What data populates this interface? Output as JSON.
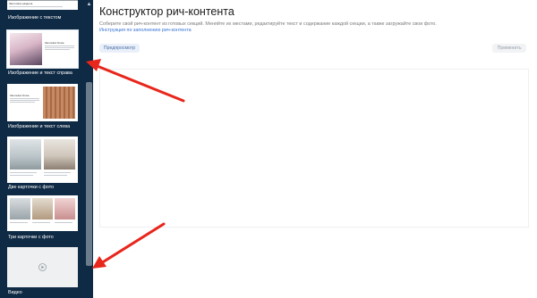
{
  "sidebar": {
    "items": [
      {
        "label": "Изображение с текстом",
        "thumb_heading": "Заголовок раздела"
      },
      {
        "label": "Изображение и текст справа",
        "thumb_heading": "Заголовок блока"
      },
      {
        "label": "Изображение и текст слева",
        "thumb_heading": "Заголовок блока"
      },
      {
        "label": "Две карточки с фото"
      },
      {
        "label": "Три карточки с фото"
      },
      {
        "label": "Видео"
      }
    ]
  },
  "main": {
    "title": "Конструктор рич-контента",
    "description": "Соберите свой рич-контент из готовых секций. Меняйте их местами, редактируйте текст и содержание каждой секции, а также загружайте свои фото.",
    "help_link": "Инструкция по заполнению рич-контента",
    "preview_button": "Предпросмотр",
    "apply_button": "Применить"
  },
  "colors": {
    "sidebar_bg": "#0f2a44",
    "annotation_arrow": "#e8261c",
    "link": "#3573d4"
  }
}
